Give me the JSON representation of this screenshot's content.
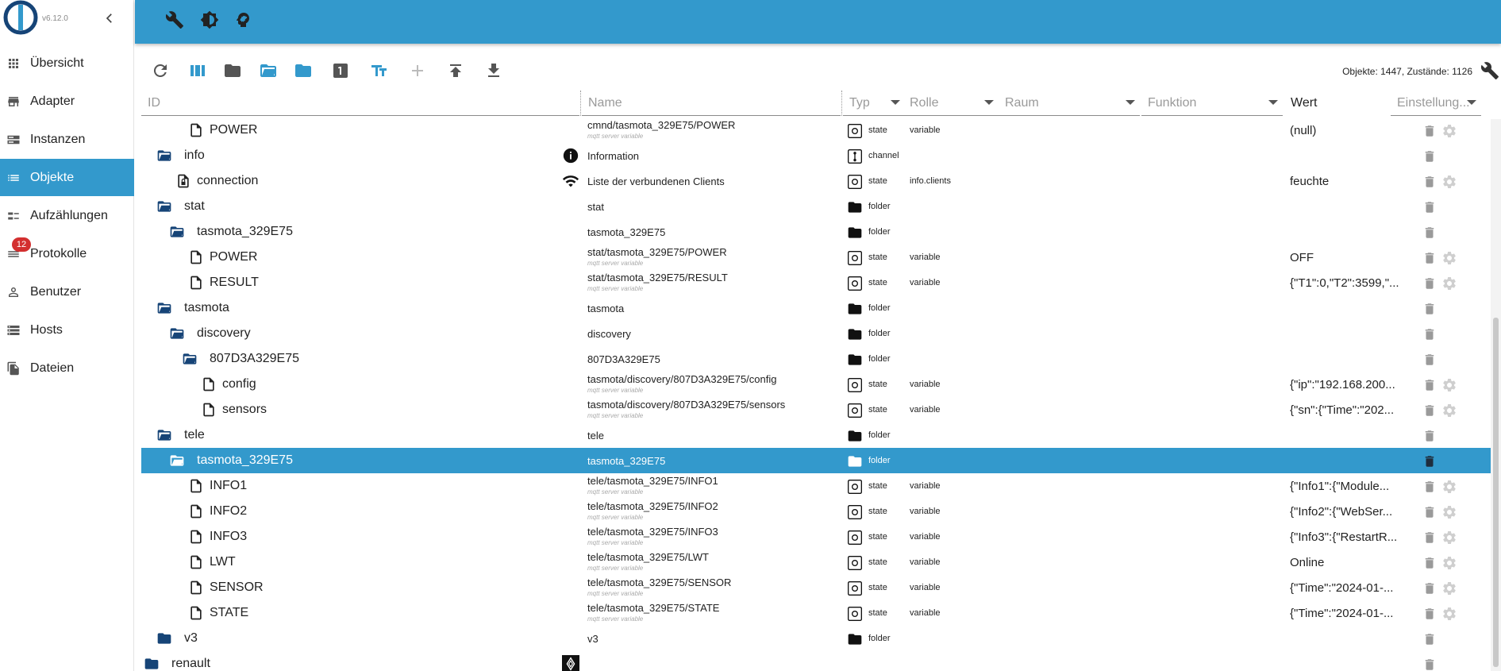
{
  "app": {
    "version": "v6.12.0",
    "brand_color": "#3399cc"
  },
  "sidebar": {
    "items": [
      {
        "label": "Übersicht",
        "icon": "apps-grid-icon"
      },
      {
        "label": "Adapter",
        "icon": "store-icon"
      },
      {
        "label": "Instanzen",
        "icon": "instances-icon"
      },
      {
        "label": "Objekte",
        "icon": "list-icon",
        "active": true
      },
      {
        "label": "Aufzählungen",
        "icon": "enum-icon"
      },
      {
        "label": "Protokolle",
        "icon": "log-list-icon",
        "badge": "12"
      },
      {
        "label": "Benutzer",
        "icon": "person-icon"
      },
      {
        "label": "Hosts",
        "icon": "storage-icon"
      },
      {
        "label": "Dateien",
        "icon": "files-icon"
      }
    ]
  },
  "topbar": {
    "icons": [
      "wrench-icon",
      "brightness-icon",
      "expert-head-icon"
    ]
  },
  "toolbar": {
    "counts": "Objekte: 1447, Zustände: 1126",
    "buttons": [
      "refresh-icon",
      "columns-icon",
      "folder-icon",
      "folder-open-icon",
      "folder-expand-icon",
      "number-one-icon",
      "text-size-icon",
      "add-icon",
      "upload-icon",
      "download-icon"
    ]
  },
  "header": {
    "id": "ID",
    "name": "Name",
    "typ": "Typ",
    "rolle": "Rolle",
    "raum": "Raum",
    "funktion": "Funktion",
    "wert": "Wert",
    "settings": "Einstellung..."
  },
  "rows": [
    {
      "label": "POWER",
      "kind": "file",
      "depth": 3,
      "name": "cmnd/tasmota_329E75/POWER",
      "sub": "mqtt server variable",
      "type": "state",
      "role": "variable",
      "value": "(null)",
      "gear": true
    },
    {
      "label": "info",
      "kind": "folder-open",
      "depth": 1,
      "name": "Information",
      "name_icon": "info-circle-icon",
      "type": "channel",
      "role": "",
      "value": "",
      "gear": false
    },
    {
      "label": "connection",
      "kind": "file-lock",
      "depth": 2,
      "name": "Liste der verbundenen Clients",
      "name_icon": "wifi-icon",
      "type": "state",
      "role": "info.clients",
      "value": "feuchte",
      "gear": true
    },
    {
      "label": "stat",
      "kind": "folder-open",
      "depth": 1,
      "name": "stat",
      "type": "folder",
      "role": "",
      "value": "",
      "gear": false
    },
    {
      "label": "tasmota_329E75",
      "kind": "folder-open",
      "depth": 2,
      "name": "tasmota_329E75",
      "type": "folder",
      "role": "",
      "value": "",
      "gear": false
    },
    {
      "label": "POWER",
      "kind": "file",
      "depth": 3,
      "name": "stat/tasmota_329E75/POWER",
      "sub": "mqtt server variable",
      "type": "state",
      "role": "variable",
      "value": "OFF",
      "gear": true
    },
    {
      "label": "RESULT",
      "kind": "file",
      "depth": 3,
      "name": "stat/tasmota_329E75/RESULT",
      "sub": "mqtt server variable",
      "type": "state",
      "role": "variable",
      "value": "{\"T1\":0,\"T2\":3599,\"...",
      "gear": true
    },
    {
      "label": "tasmota",
      "kind": "folder-open",
      "depth": 1,
      "name": "tasmota",
      "type": "folder",
      "role": "",
      "value": "",
      "gear": false
    },
    {
      "label": "discovery",
      "kind": "folder-open",
      "depth": 2,
      "name": "discovery",
      "type": "folder",
      "role": "",
      "value": "",
      "gear": false
    },
    {
      "label": "807D3A329E75",
      "kind": "folder-open",
      "depth": 3,
      "name": "807D3A329E75",
      "type": "folder",
      "role": "",
      "value": "",
      "gear": false
    },
    {
      "label": "config",
      "kind": "file",
      "depth": 4,
      "name": "tasmota/discovery/807D3A329E75/config",
      "sub": "mqtt server variable",
      "type": "state",
      "role": "variable",
      "value": "{\"ip\":\"192.168.200...",
      "gear": true
    },
    {
      "label": "sensors",
      "kind": "file",
      "depth": 4,
      "name": "tasmota/discovery/807D3A329E75/sensors",
      "sub": "mqtt server variable",
      "type": "state",
      "role": "variable",
      "value": "{\"sn\":{\"Time\":\"202...",
      "gear": true
    },
    {
      "label": "tele",
      "kind": "folder-open",
      "depth": 1,
      "name": "tele",
      "type": "folder",
      "role": "",
      "value": "",
      "gear": false
    },
    {
      "label": "tasmota_329E75",
      "kind": "folder-open",
      "depth": 2,
      "name": "tasmota_329E75",
      "type": "folder",
      "role": "",
      "value": "",
      "gear": false,
      "selected": true
    },
    {
      "label": "INFO1",
      "kind": "file",
      "depth": 3,
      "name": "tele/tasmota_329E75/INFO1",
      "sub": "mqtt server variable",
      "type": "state",
      "role": "variable",
      "value": "{\"Info1\":{\"Module...",
      "gear": true
    },
    {
      "label": "INFO2",
      "kind": "file",
      "depth": 3,
      "name": "tele/tasmota_329E75/INFO2",
      "sub": "mqtt server variable",
      "type": "state",
      "role": "variable",
      "value": "{\"Info2\":{\"WebSer...",
      "gear": true
    },
    {
      "label": "INFO3",
      "kind": "file",
      "depth": 3,
      "name": "tele/tasmota_329E75/INFO3",
      "sub": "mqtt server variable",
      "type": "state",
      "role": "variable",
      "value": "{\"Info3\":{\"RestartR...",
      "gear": true
    },
    {
      "label": "LWT",
      "kind": "file",
      "depth": 3,
      "name": "tele/tasmota_329E75/LWT",
      "sub": "mqtt server variable",
      "type": "state",
      "role": "variable",
      "value": "Online",
      "gear": true
    },
    {
      "label": "SENSOR",
      "kind": "file",
      "depth": 3,
      "name": "tele/tasmota_329E75/SENSOR",
      "sub": "mqtt server variable",
      "type": "state",
      "role": "variable",
      "value": "{\"Time\":\"2024-01-...",
      "gear": true
    },
    {
      "label": "STATE",
      "kind": "file",
      "depth": 3,
      "name": "tele/tasmota_329E75/STATE",
      "sub": "mqtt server variable",
      "type": "state",
      "role": "variable",
      "value": "{\"Time\":\"2024-01-...",
      "gear": true
    },
    {
      "label": "v3",
      "kind": "folder",
      "depth": 1,
      "name": "v3",
      "type": "folder",
      "role": "",
      "value": "",
      "gear": false
    },
    {
      "label": "renault",
      "kind": "folder",
      "depth": 0,
      "name": "",
      "name_icon": "renault-logo-icon",
      "type": "",
      "role": "",
      "value": "",
      "gear": false
    }
  ]
}
